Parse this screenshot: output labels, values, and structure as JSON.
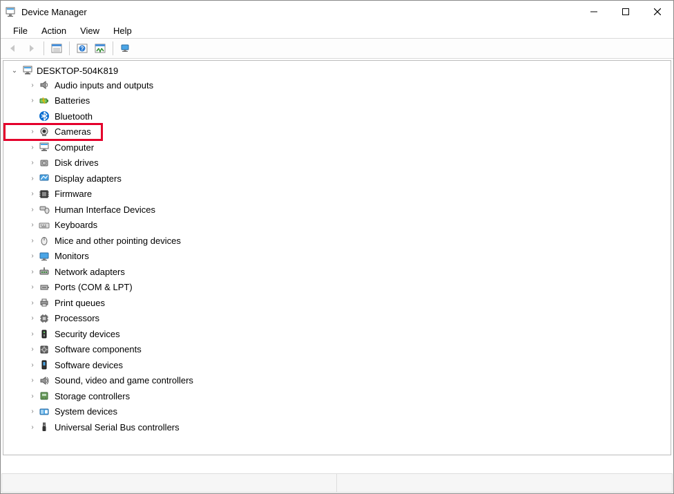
{
  "window": {
    "title": "Device Manager"
  },
  "menu": {
    "items": [
      "File",
      "Action",
      "View",
      "Help"
    ]
  },
  "toolbar": {
    "back": "back",
    "forward": "forward",
    "properties": "properties",
    "help": "help",
    "scan": "scan",
    "show": "show"
  },
  "tree": {
    "root_label": "DESKTOP-504K819",
    "nodes": [
      {
        "label": "Audio inputs and outputs",
        "icon": "speaker",
        "expandable": true,
        "highlight": false
      },
      {
        "label": "Batteries",
        "icon": "battery",
        "expandable": true,
        "highlight": false
      },
      {
        "label": "Bluetooth",
        "icon": "bluetooth",
        "expandable": false,
        "highlight": false
      },
      {
        "label": "Cameras",
        "icon": "camera",
        "expandable": true,
        "highlight": true
      },
      {
        "label": "Computer",
        "icon": "computer",
        "expandable": true,
        "highlight": false
      },
      {
        "label": "Disk drives",
        "icon": "disk",
        "expandable": true,
        "highlight": false
      },
      {
        "label": "Display adapters",
        "icon": "display",
        "expandable": true,
        "highlight": false
      },
      {
        "label": "Firmware",
        "icon": "firmware",
        "expandable": true,
        "highlight": false
      },
      {
        "label": "Human Interface Devices",
        "icon": "hid",
        "expandable": true,
        "highlight": false
      },
      {
        "label": "Keyboards",
        "icon": "keyboard",
        "expandable": true,
        "highlight": false
      },
      {
        "label": "Mice and other pointing devices",
        "icon": "mouse",
        "expandable": true,
        "highlight": false
      },
      {
        "label": "Monitors",
        "icon": "monitor",
        "expandable": true,
        "highlight": false
      },
      {
        "label": "Network adapters",
        "icon": "network",
        "expandable": true,
        "highlight": false
      },
      {
        "label": "Ports (COM & LPT)",
        "icon": "port",
        "expandable": true,
        "highlight": false
      },
      {
        "label": "Print queues",
        "icon": "printer",
        "expandable": true,
        "highlight": false
      },
      {
        "label": "Processors",
        "icon": "cpu",
        "expandable": true,
        "highlight": false
      },
      {
        "label": "Security devices",
        "icon": "security",
        "expandable": true,
        "highlight": false
      },
      {
        "label": "Software components",
        "icon": "swcomp",
        "expandable": true,
        "highlight": false
      },
      {
        "label": "Software devices",
        "icon": "swdev",
        "expandable": true,
        "highlight": false
      },
      {
        "label": "Sound, video and game controllers",
        "icon": "sound",
        "expandable": true,
        "highlight": false
      },
      {
        "label": "Storage controllers",
        "icon": "storage",
        "expandable": true,
        "highlight": false
      },
      {
        "label": "System devices",
        "icon": "system",
        "expandable": true,
        "highlight": false
      },
      {
        "label": "Universal Serial Bus controllers",
        "icon": "usb",
        "expandable": true,
        "highlight": false
      }
    ]
  }
}
